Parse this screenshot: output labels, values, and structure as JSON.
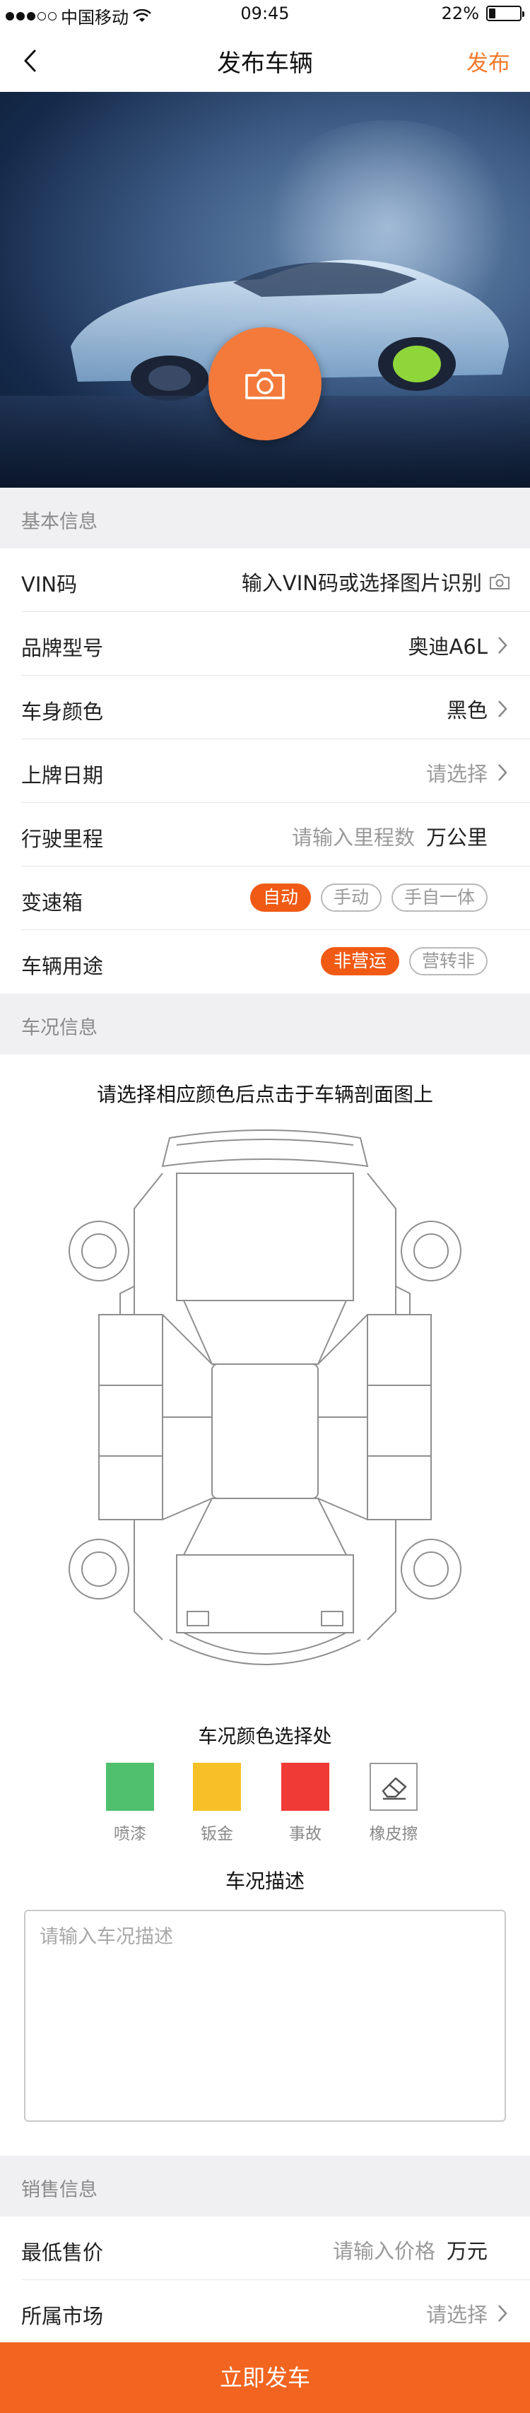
{
  "status_bar": {
    "carrier": "中国移动",
    "time": "09:45",
    "battery": "22%",
    "battery_level": 0.22
  },
  "nav": {
    "title": "发布车辆",
    "publish_label": "发布"
  },
  "basic_info": {
    "header": "基本信息",
    "vin": {
      "label": "VIN码",
      "placeholder": "输入VIN码或选择图片识别"
    },
    "brand": {
      "label": "品牌型号",
      "value": "奥迪A6L"
    },
    "color": {
      "label": "车身颜色",
      "value": "黑色"
    },
    "reg_date": {
      "label": "上牌日期",
      "placeholder": "请选择"
    },
    "mileage": {
      "label": "行驶里程",
      "placeholder": "请输入里程数",
      "unit": "万公里"
    },
    "gearbox": {
      "label": "变速箱",
      "options": [
        "自动",
        "手动",
        "手自一体"
      ],
      "selected": "自动"
    },
    "usage": {
      "label": "车辆用途",
      "options": [
        "非营运",
        "营转非"
      ],
      "selected": "非营运"
    }
  },
  "condition": {
    "header": "车况信息",
    "instruction": "请选择相应颜色后点击于车辆剖面图上",
    "palette_title": "车况颜色选择处",
    "palette": [
      {
        "label": "喷漆",
        "color": "#4fc06e"
      },
      {
        "label": "钣金",
        "color": "#f6c026"
      },
      {
        "label": "事故",
        "color": "#f03a35"
      },
      {
        "label": "橡皮擦",
        "color": "#ffffff",
        "icon": "eraser-icon"
      }
    ],
    "description_title": "车况描述",
    "description_placeholder": "请输入车况描述"
  },
  "sales": {
    "header": "销售信息",
    "min_price": {
      "label": "最低售价",
      "placeholder": "请输入价格",
      "unit": "万元"
    },
    "market": {
      "label": "所属市场",
      "placeholder": "请选择"
    }
  },
  "submit_label": "立即发车",
  "colors": {
    "accent": "#f26520",
    "section_bg": "#f0f0f2"
  }
}
